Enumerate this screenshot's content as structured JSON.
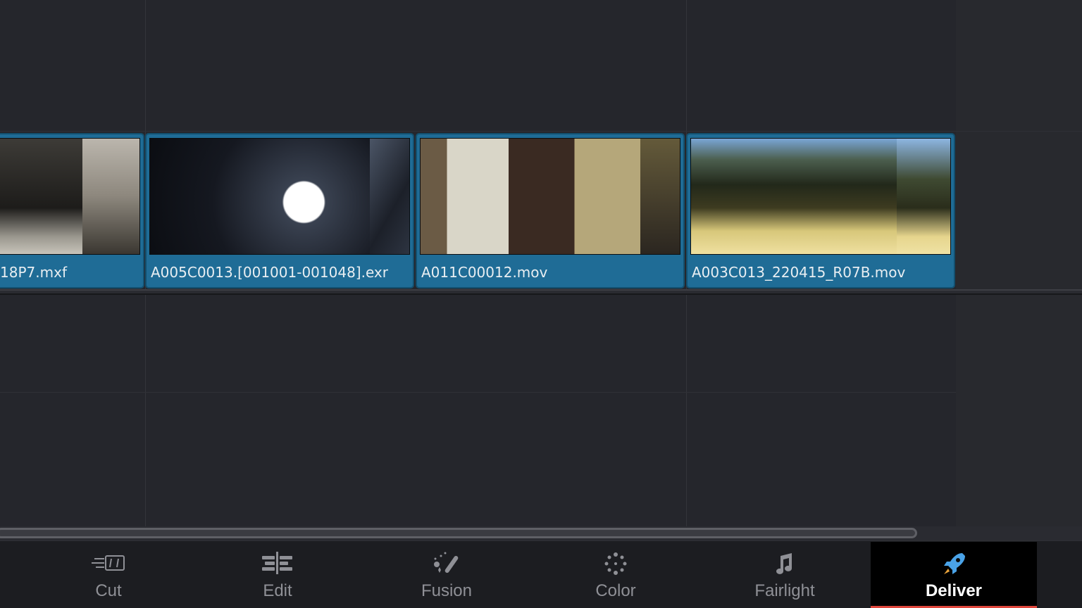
{
  "timeline": {
    "clips": [
      {
        "name": "18P7.mxf"
      },
      {
        "name": "A005C0013.[001001-001048].exr"
      },
      {
        "name": "A011C00012.mov"
      },
      {
        "name": "A003C013_220415_R07B.mov"
      }
    ]
  },
  "pages": [
    {
      "label": "Cut",
      "icon": "cut-page-icon",
      "active": false
    },
    {
      "label": "Edit",
      "icon": "edit-page-icon",
      "active": false
    },
    {
      "label": "Fusion",
      "icon": "fusion-page-icon",
      "active": false
    },
    {
      "label": "Color",
      "icon": "color-page-icon",
      "active": false
    },
    {
      "label": "Fairlight",
      "icon": "fairlight-page-icon",
      "active": false
    },
    {
      "label": "Deliver",
      "icon": "deliver-page-icon",
      "active": true
    }
  ],
  "colors": {
    "clip_fill": "#1f6c96",
    "active_underline": "#e0463c",
    "deliver_icon": "#4aa3e8"
  }
}
